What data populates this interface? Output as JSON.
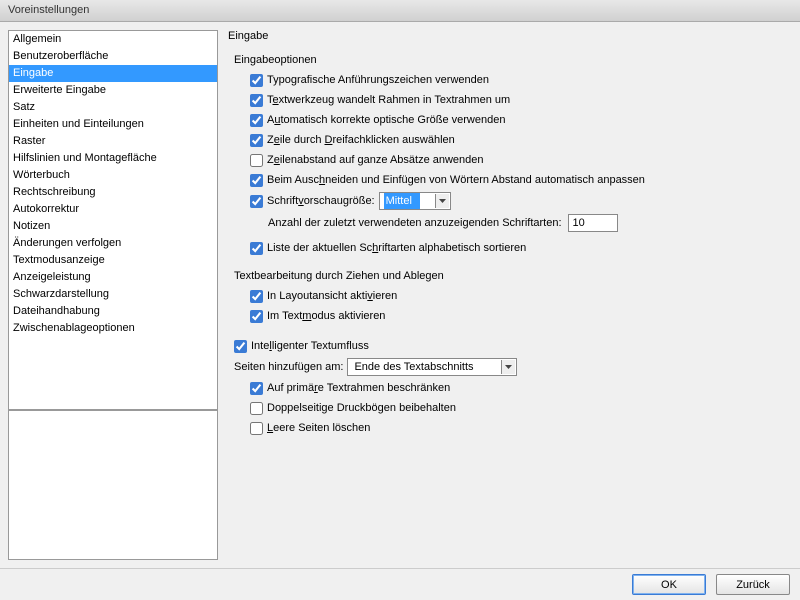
{
  "window": {
    "title": "Voreinstellungen"
  },
  "sidebar": {
    "items": [
      {
        "label": "Allgemein"
      },
      {
        "label": "Benutzeroberfläche"
      },
      {
        "label": "Eingabe"
      },
      {
        "label": "Erweiterte Eingabe"
      },
      {
        "label": "Satz"
      },
      {
        "label": "Einheiten und Einteilungen"
      },
      {
        "label": "Raster"
      },
      {
        "label": "Hilfslinien und Montagefläche"
      },
      {
        "label": "Wörterbuch"
      },
      {
        "label": "Rechtschreibung"
      },
      {
        "label": "Autokorrektur"
      },
      {
        "label": "Notizen"
      },
      {
        "label": "Änderungen verfolgen"
      },
      {
        "label": "Textmodusanzeige"
      },
      {
        "label": "Anzeigeleistung"
      },
      {
        "label": "Schwarzdarstellung"
      },
      {
        "label": "Dateihandhabung"
      },
      {
        "label": "Zwischenablageoptionen"
      }
    ],
    "selected_index": 2
  },
  "panel": {
    "title": "Eingabe",
    "group_input_options": {
      "title": "Eingabeoptionen",
      "typographic_quotes": {
        "label": "Typografische Anführungszeichen verwenden",
        "checked": true
      },
      "text_tool_frame": {
        "label_pre": "T",
        "label_u": "e",
        "label_post": "xtwerkzeug wandelt Rahmen in Textrahmen um",
        "checked": true
      },
      "auto_optical_size": {
        "label_pre": "A",
        "label_u": "u",
        "label_post": "tomatisch korrekte optische Größe verwenden",
        "checked": true
      },
      "triple_click": {
        "label_pre": "Z",
        "label_u": "e",
        "label_post": "ile durch ",
        "label_u2": "D",
        "label_post2": "reifachklicken auswählen",
        "checked": true
      },
      "leading_whole_para": {
        "label_pre": "Z",
        "label_u": "e",
        "label_post": "ilenabstand auf ganze Absätze anwenden",
        "checked": false
      },
      "adjust_spacing_cut_paste": {
        "label_pre": "Beim Ausc",
        "label_u": "h",
        "label_post": "neiden und Einfügen von Wörtern Abstand automatisch anpassen",
        "checked": true
      },
      "font_preview": {
        "label_pre": "Schrift",
        "label_u": "v",
        "label_post": "orschaugröße:",
        "value": "Mittel",
        "checked": true
      },
      "recent_fonts": {
        "label": "Anzahl der zuletzt verwendeten anzuzeigenden Schriftarten:",
        "value": "10"
      },
      "alpha_sort_fonts": {
        "label_pre": "Liste der aktuellen Sc",
        "label_u": "h",
        "label_post": "riftarten alphabetisch sortieren",
        "checked": true
      }
    },
    "group_drag_drop": {
      "title": "Textbearbeitung durch Ziehen und Ablegen",
      "layout_view": {
        "label_pre": "In Layoutansicht akti",
        "label_u": "v",
        "label_post": "ieren",
        "checked": true
      },
      "text_mode": {
        "label_pre": "Im Text",
        "label_u": "m",
        "label_post": "odus aktivieren",
        "checked": true
      }
    },
    "group_smart_reflow": {
      "smart_reflow": {
        "label_pre": "Inte",
        "label_u": "l",
        "label_post": "ligenter Textumfluss",
        "checked": true
      },
      "add_pages": {
        "label": "Seiten hinzufügen am:",
        "value": "Ende des Textabschnitts"
      },
      "primary_frames": {
        "label_pre": "Auf primä",
        "label_u": "r",
        "label_post": "e Textrahmen beschränken",
        "checked": true
      },
      "preserve_spreads": {
        "label": "Doppelseitige Druckbögen beibehalten",
        "checked": false
      },
      "delete_empty": {
        "label_pre": "",
        "label_u": "L",
        "label_post": "eere Seiten löschen",
        "checked": false
      }
    }
  },
  "buttons": {
    "ok": "OK",
    "back": "Zurück"
  }
}
